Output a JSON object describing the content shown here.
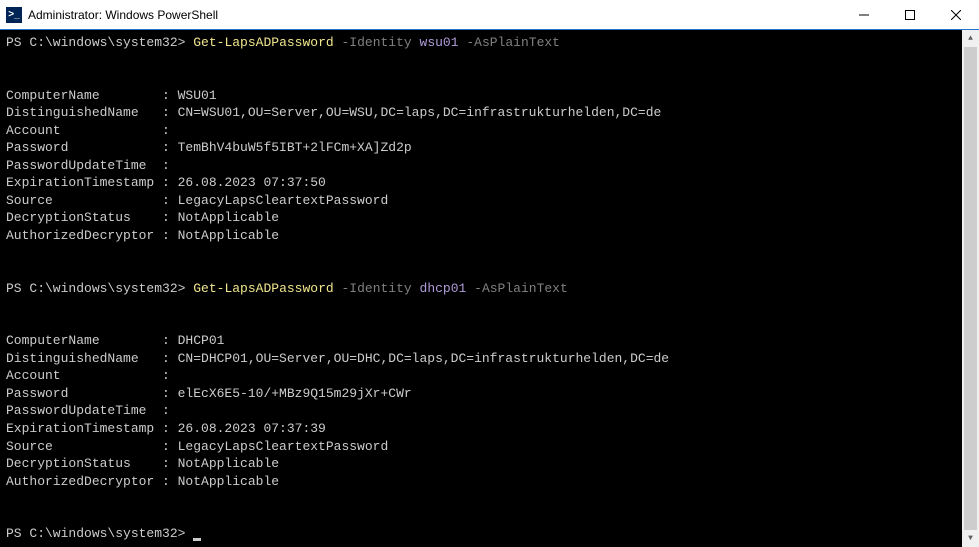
{
  "window": {
    "title": "Administrator: Windows PowerShell",
    "icon_label": ">_"
  },
  "terminal": {
    "prompt": "PS C:\\windows\\system32>",
    "commands": [
      {
        "cmdlet": "Get-LapsADPassword",
        "param1": "-Identity",
        "value1": "wsu01",
        "param2": "-AsPlainText"
      },
      {
        "cmdlet": "Get-LapsADPassword",
        "param1": "-Identity",
        "value1": "dhcp01",
        "param2": "-AsPlainText"
      }
    ],
    "outputs": [
      {
        "ComputerName": "WSU01",
        "DistinguishedName": "CN=WSU01,OU=Server,OU=WSU,DC=laps,DC=infrastrukturhelden,DC=de",
        "Account": "",
        "Password": "TemBhV4buW5f5IBT+2lFCm+XA]Zd2p",
        "PasswordUpdateTime": "",
        "ExpirationTimestamp": "26.08.2023 07:37:50",
        "Source": "LegacyLapsCleartextPassword",
        "DecryptionStatus": "NotApplicable",
        "AuthorizedDecryptor": "NotApplicable"
      },
      {
        "ComputerName": "DHCP01",
        "DistinguishedName": "CN=DHCP01,OU=Server,OU=DHC,DC=laps,DC=infrastrukturhelden,DC=de",
        "Account": "",
        "Password": "elEcX6E5-10/+MBz9Q15m29jXr+CWr",
        "PasswordUpdateTime": "",
        "ExpirationTimestamp": "26.08.2023 07:37:39",
        "Source": "LegacyLapsCleartextPassword",
        "DecryptionStatus": "NotApplicable",
        "AuthorizedDecryptor": "NotApplicable"
      }
    ],
    "field_order": [
      "ComputerName",
      "DistinguishedName",
      "Account",
      "Password",
      "PasswordUpdateTime",
      "ExpirationTimestamp",
      "Source",
      "DecryptionStatus",
      "AuthorizedDecryptor"
    ],
    "label_width": 19
  }
}
